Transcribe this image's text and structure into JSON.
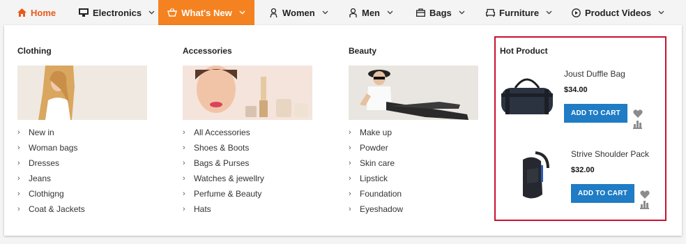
{
  "nav": {
    "items": [
      {
        "label": "Home",
        "icon": "home-icon"
      },
      {
        "label": "Electronics",
        "icon": "monitor-icon"
      },
      {
        "label": "What's New",
        "icon": "basket-icon"
      },
      {
        "label": "Women",
        "icon": "woman-icon"
      },
      {
        "label": "Men",
        "icon": "man-icon"
      },
      {
        "label": "Bags",
        "icon": "briefcase-icon"
      },
      {
        "label": "Furniture",
        "icon": "armchair-icon"
      },
      {
        "label": "Product Videos",
        "icon": "play-icon"
      }
    ],
    "active_color": "#f58220",
    "home_color": "#e85a1b"
  },
  "menu": {
    "columns": [
      {
        "title": "Clothing",
        "links": [
          "New in",
          "Woman bags",
          "Dresses",
          "Jeans",
          "Clothigng",
          "Coat & Jackets"
        ]
      },
      {
        "title": "Accessories",
        "links": [
          "All Accessories",
          "Shoes & Boots",
          "Bags & Purses",
          "Watches & jewellry",
          "Perfume & Beauty",
          "Hats"
        ]
      },
      {
        "title": "Beauty",
        "links": [
          "Make up",
          "Powder",
          "Skin care",
          "Lipstick",
          "Foundation",
          "Eyeshadow"
        ]
      }
    ]
  },
  "hot_product": {
    "title": "Hot Product",
    "border_color": "#c8102e",
    "products": [
      {
        "name": "Joust Duffle Bag",
        "price": "$34.00",
        "button": "ADD TO CART"
      },
      {
        "name": "Strive Shoulder Pack",
        "price": "$32.00",
        "button": "ADD TO CART"
      }
    ],
    "button_color": "#1f7cc5"
  }
}
